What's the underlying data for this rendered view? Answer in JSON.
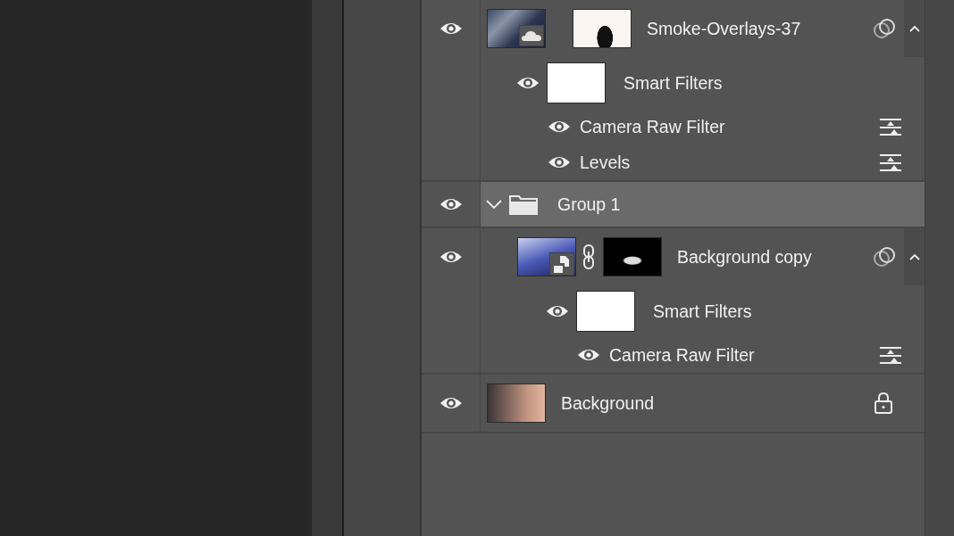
{
  "layers": [
    {
      "kind": "layer",
      "name": "Smoke-Overlays-37",
      "visible": true,
      "selected": false,
      "cloud_badge": true,
      "smart_object_badge": false,
      "linked": false,
      "mask": true,
      "expanded": true,
      "smart_filters": {
        "label": "Smart Filters",
        "visible": true,
        "filters": [
          {
            "name": "Camera Raw Filter",
            "visible": true
          },
          {
            "name": "Levels",
            "visible": true
          }
        ]
      }
    },
    {
      "kind": "group",
      "name": "Group 1",
      "visible": true,
      "selected": true,
      "expanded": true,
      "children": [
        {
          "kind": "layer",
          "name": "Background copy",
          "visible": true,
          "selected": false,
          "cloud_badge": false,
          "smart_object_badge": true,
          "linked": true,
          "mask": true,
          "expanded": true,
          "smart_filters": {
            "label": "Smart Filters",
            "visible": true,
            "filters": [
              {
                "name": "Camera Raw Filter",
                "visible": true
              }
            ]
          }
        }
      ]
    },
    {
      "kind": "layer",
      "name": "Background",
      "visible": true,
      "selected": false,
      "cloud_badge": false,
      "smart_object_badge": false,
      "linked": false,
      "mask": false,
      "locked": true
    }
  ]
}
